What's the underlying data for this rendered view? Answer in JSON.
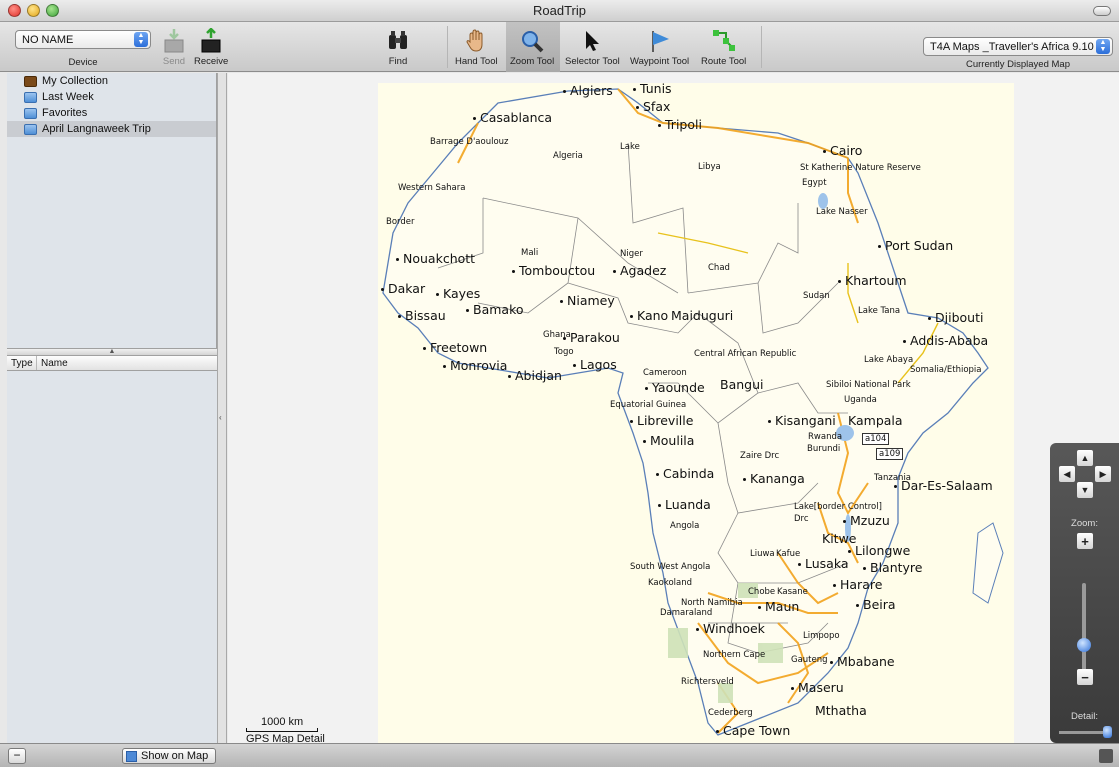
{
  "window": {
    "title": "RoadTrip"
  },
  "toolbar": {
    "device_label": "Device",
    "device_value": "NO NAME",
    "send_label": "Send",
    "receive_label": "Receive",
    "find_label": "Find",
    "tools": [
      {
        "label": "Hand Tool",
        "icon": "hand-icon"
      },
      {
        "label": "Zoom Tool",
        "icon": "magnifier-icon",
        "active": true
      },
      {
        "label": "Selector Tool",
        "icon": "arrow-pointer-icon"
      },
      {
        "label": "Waypoint Tool",
        "icon": "flag-icon"
      },
      {
        "label": "Route Tool",
        "icon": "route-icon"
      }
    ],
    "map_value": "T4A Maps _Traveller's Africa 9.10",
    "map_label": "Currently Displayed Map"
  },
  "sidebar": {
    "items": [
      {
        "label": "My Collection",
        "icon": "briefcase-icon"
      },
      {
        "label": "Last Week",
        "icon": "folder-icon"
      },
      {
        "label": "Favorites",
        "icon": "folder-icon"
      },
      {
        "label": "April Langnaweek Trip",
        "icon": "folder-icon",
        "selected": true
      }
    ],
    "list_columns": [
      "Type",
      "Name"
    ]
  },
  "map": {
    "scale_label": "1000 km",
    "detail_label": "GPS Map Detail",
    "cities": [
      "Algiers",
      "Tunis",
      "Sfax",
      "Tripoli",
      "Casablanca",
      "Cairo",
      "Port Sudan",
      "Nouakchott",
      "Tombouctou",
      "Agadez",
      "Dakar",
      "Kayes",
      "Bissau",
      "Bamako",
      "Niamey",
      "Kano",
      "Maiduguri",
      "Khartoum",
      "Djibouti",
      "Addis-Ababa",
      "Freetown",
      "Monrovia",
      "Abidjan",
      "Parakou",
      "Lagos",
      "Yaounde",
      "Bangui",
      "Libreville",
      "Moulila",
      "Kisangani",
      "Kampala",
      "Cabinda",
      "Kananga",
      "Dar-Es-Salaam",
      "Luanda",
      "Mzuzu",
      "Kitwe",
      "Lilongwe",
      "Lusaka",
      "Blantyre",
      "Harare",
      "Beira",
      "Maun",
      "Windhoek",
      "Mbabane",
      "Maseru",
      "Mthatha",
      "Cape Town"
    ],
    "regions": [
      "Barrage D'aoulouz",
      "Algeria",
      "Lake",
      "Libya",
      "Border",
      "St Katherine Nature Reserve",
      "Egypt",
      "Western Sahara",
      "Lake Nasser",
      "Mali",
      "Niger",
      "Chad",
      "Sudan",
      "Lake Tana",
      "Ghana",
      "Togo",
      "Central African Republic",
      "Cameroon",
      "Lake Abaya",
      "Somalia/Ethiopia",
      "Sibiloi National Park",
      "Equatorial Guinea",
      "Uganda",
      "Rwanda",
      "Burundi",
      "Zaire Drc",
      "Tanzania",
      "a104",
      "a109",
      "Lake[border Control]",
      "Drc",
      "Angola",
      "Liuwa",
      "Kafue",
      "South West Angola",
      "Kaokoland",
      "Chobe",
      "Kasane",
      "North Namibia",
      "Damaraland",
      "Limpopo",
      "Northern Cape",
      "Gauteng",
      "Richtersveld",
      "Cederberg"
    ]
  },
  "navigation": {
    "zoom_label": "Zoom:",
    "detail_label": "Detail:",
    "zoom_level": 0.55,
    "detail_level": 1.0
  },
  "statusbar": {
    "show_on_map_label": "Show on Map"
  }
}
